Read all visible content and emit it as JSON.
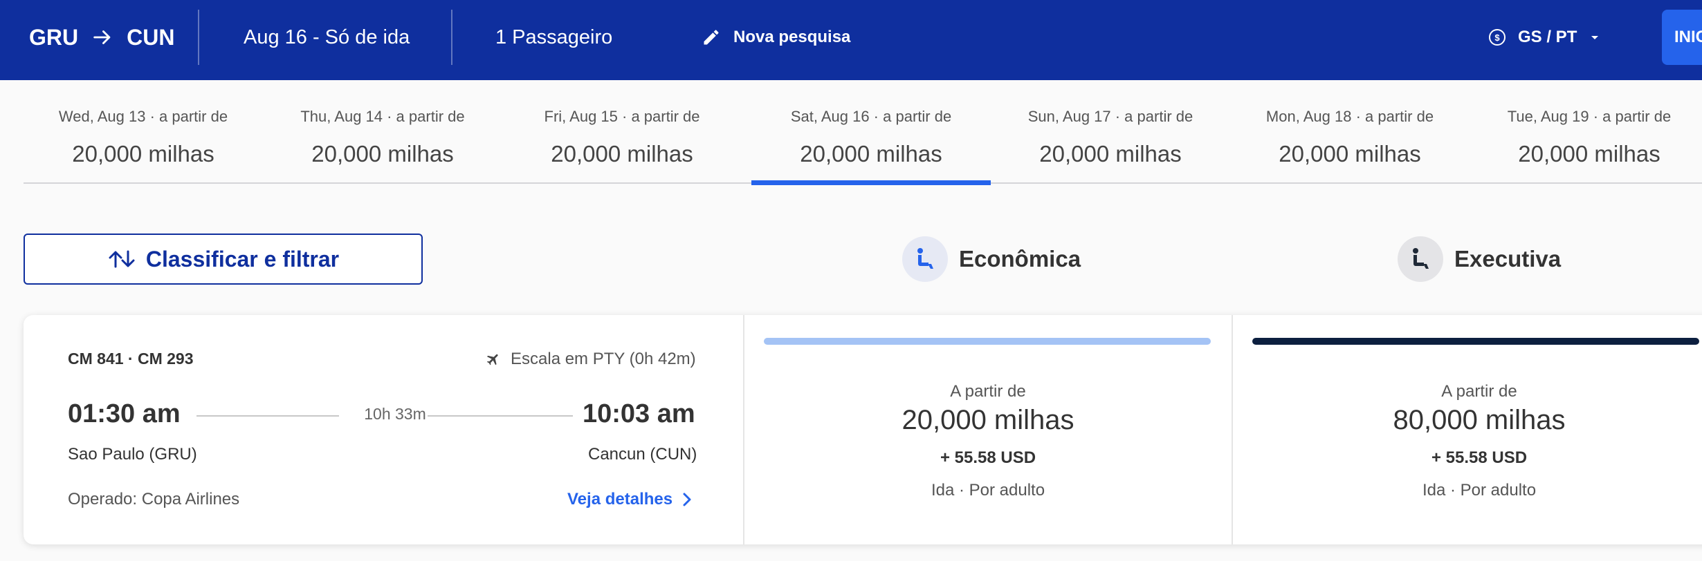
{
  "header": {
    "origin": "GRU",
    "destination": "CUN",
    "date_label": "Aug 16 - Só de ida",
    "passengers": "1 Passageiro",
    "new_search": "Nova pesquisa",
    "locale": "GS / PT",
    "login_label": "INIC"
  },
  "dates": [
    {
      "label": "Wed, Aug 13 · a partir de",
      "price": "20,000 milhas"
    },
    {
      "label": "Thu, Aug 14 · a partir de",
      "price": "20,000 milhas"
    },
    {
      "label": "Fri, Aug 15 · a partir de",
      "price": "20,000 milhas"
    },
    {
      "label": "Sat, Aug 16 · a partir de",
      "price": "20,000 milhas",
      "selected": true
    },
    {
      "label": "Sun, Aug 17 · a partir de",
      "price": "20,000 milhas"
    },
    {
      "label": "Mon, Aug 18 · a partir de",
      "price": "20,000 milhas"
    },
    {
      "label": "Tue, Aug 19 · a partir de",
      "price": "20,000 milhas"
    }
  ],
  "filter": {
    "label": "Classificar e filtrar"
  },
  "cabins": {
    "economy": "Econômica",
    "business": "Executiva"
  },
  "flight": {
    "numbers": "CM 841 · CM 293",
    "stop": "Escala em PTY (0h 42m)",
    "departure_time": "01:30 am",
    "arrival_time": "10:03 am",
    "duration": "10h 33m",
    "departure_city": "Sao Paulo (GRU)",
    "arrival_city": "Cancun (CUN)",
    "operated_by": "Operado: Copa Airlines",
    "details_link": "Veja detalhes"
  },
  "fares": {
    "economy": {
      "from": "A partir de",
      "miles": "20,000 milhas",
      "tax": "+ 55.58 USD",
      "note": "Ida · Por adulto"
    },
    "business": {
      "from": "A partir de",
      "miles": "80,000 milhas",
      "tax": "+ 55.58 USD",
      "note": "Ida · Por adulto"
    }
  },
  "colors": {
    "header_bg": "#0f2f9e",
    "accent": "#2563eb",
    "economy_bar": "#a4c3f5",
    "business_bar": "#0c1f3f"
  },
  "icons": {
    "route": "arrow-right-icon",
    "new_search": "pencil-icon",
    "locale": "currency-icon",
    "locale_dropdown": "caret-down-icon",
    "filter": "sort-arrows-icon",
    "economy": "seat-icon",
    "business": "seat-icon",
    "stop": "airplane-icon",
    "details": "chevron-right-icon"
  }
}
